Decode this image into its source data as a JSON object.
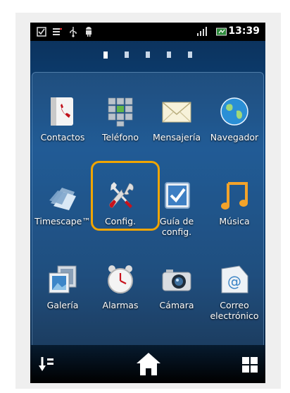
{
  "status_bar": {
    "time": "13:39",
    "icons": [
      "checkbox-notification-icon",
      "list-notification-icon",
      "usb-icon",
      "android-icon",
      "signal-icon",
      "battery-icon"
    ]
  },
  "pager": {
    "pages": 5,
    "active_index": 0
  },
  "apps": [
    {
      "label": "Contactos",
      "icon": "contacts-icon"
    },
    {
      "label": "Teléfono",
      "icon": "phone-keypad-icon"
    },
    {
      "label": "Mensajería",
      "icon": "envelope-icon"
    },
    {
      "label": "Navegador",
      "icon": "globe-icon"
    },
    {
      "label": "Timescape™",
      "icon": "timescape-icon"
    },
    {
      "label": "Config.",
      "icon": "wrench-screwdriver-icon"
    },
    {
      "label": "Guía de config.",
      "icon": "checkbox-icon"
    },
    {
      "label": "Música",
      "icon": "music-note-icon"
    },
    {
      "label": "Galería",
      "icon": "gallery-icon"
    },
    {
      "label": "Alarmas",
      "icon": "alarm-clock-icon"
    },
    {
      "label": "Cámara",
      "icon": "camera-icon"
    },
    {
      "label": "Correo electrónico",
      "icon": "email-at-icon"
    }
  ],
  "highlighted_app": "Config.",
  "highlight_color": "#f0a500",
  "dock": {
    "left": "sort-icon",
    "center": "home-icon",
    "right": "apps-grid-icon"
  }
}
